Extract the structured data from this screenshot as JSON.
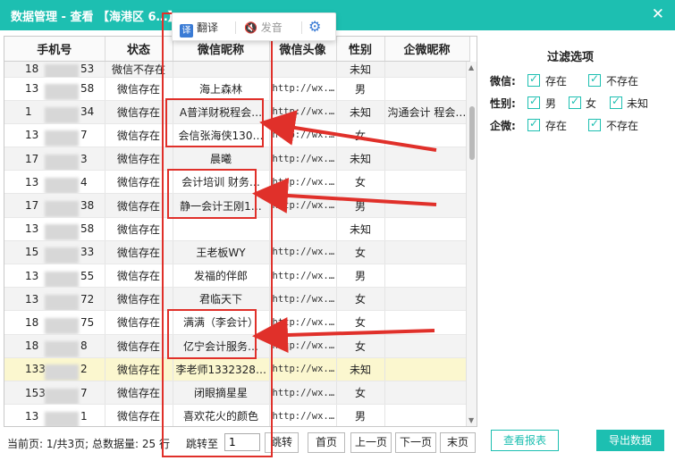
{
  "window": {
    "title": "数据管理 - 查看 【海港区 6…】",
    "close_icon": "close-icon"
  },
  "toolbar": {
    "translate_label": "翻译",
    "translate_icon_text": "译",
    "voice_label": "发音",
    "voice_icon": "speaker-icon",
    "settings_icon": "gear-icon"
  },
  "table": {
    "columns": [
      "手机号",
      "状态",
      "微信昵称",
      "微信头像",
      "性别",
      "企微昵称"
    ],
    "rows": [
      {
        "phone_prefix": "18",
        "phone_suffix": "53",
        "status": "微信不存在",
        "nickname": "",
        "avatar": "",
        "gender": "未知",
        "wecom": ""
      },
      {
        "phone_prefix": "13",
        "phone_suffix": "58",
        "status": "微信存在",
        "nickname": "海上森林",
        "avatar": "http://wx.…",
        "gender": "男",
        "wecom": ""
      },
      {
        "phone_prefix": "1",
        "phone_suffix": "34",
        "status": "微信存在",
        "nickname": "A普洋财税程会…",
        "avatar": "http://wx.…",
        "gender": "未知",
        "wecom": "沟通会计 程会…"
      },
      {
        "phone_prefix": "13",
        "phone_suffix": "7",
        "status": "微信存在",
        "nickname": "会信张海侠130…",
        "avatar": "http://wx.…",
        "gender": "女",
        "wecom": ""
      },
      {
        "phone_prefix": "17",
        "phone_suffix": "3",
        "status": "微信存在",
        "nickname": "晨曦",
        "avatar": "http://wx.…",
        "gender": "未知",
        "wecom": ""
      },
      {
        "phone_prefix": "13",
        "phone_suffix": "4",
        "status": "微信存在",
        "nickname": "会计培训 财务…",
        "avatar": "http://wx.…",
        "gender": "女",
        "wecom": ""
      },
      {
        "phone_prefix": "17",
        "phone_suffix": "38",
        "status": "微信存在",
        "nickname": "静一会计王刚1…",
        "avatar": "http://wx.…",
        "gender": "男",
        "wecom": ""
      },
      {
        "phone_prefix": "13",
        "phone_suffix": "58",
        "status": "微信存在",
        "nickname": "",
        "avatar": "",
        "gender": "未知",
        "wecom": ""
      },
      {
        "phone_prefix": "15",
        "phone_suffix": "33",
        "status": "微信存在",
        "nickname": "王老板WY",
        "avatar": "http://wx.…",
        "gender": "女",
        "wecom": ""
      },
      {
        "phone_prefix": "13",
        "phone_suffix": "55",
        "status": "微信存在",
        "nickname": "发福的伴郎",
        "avatar": "http://wx.…",
        "gender": "男",
        "wecom": ""
      },
      {
        "phone_prefix": "13",
        "phone_suffix": "72",
        "status": "微信存在",
        "nickname": "君临天下",
        "avatar": "http://wx.…",
        "gender": "女",
        "wecom": ""
      },
      {
        "phone_prefix": "18",
        "phone_suffix": "75",
        "status": "微信存在",
        "nickname": "满满（李会计）",
        "avatar": "http://wx.…",
        "gender": "女",
        "wecom": ""
      },
      {
        "phone_prefix": "18",
        "phone_suffix": "8",
        "status": "微信存在",
        "nickname": "亿宁会计服务…",
        "avatar": "http://wx.…",
        "gender": "女",
        "wecom": ""
      },
      {
        "phone_prefix": "133",
        "phone_suffix": "2",
        "status": "微信存在",
        "nickname": "李老师1332328…",
        "avatar": "http://wx.…",
        "gender": "未知",
        "wecom": ""
      },
      {
        "phone_prefix": "153",
        "phone_suffix": "7",
        "status": "微信存在",
        "nickname": "闭眼摘星星",
        "avatar": "http://wx.…",
        "gender": "女",
        "wecom": ""
      },
      {
        "phone_prefix": "13",
        "phone_suffix": "1",
        "status": "微信存在",
        "nickname": "喜欢花火的颜色",
        "avatar": "http://wx.…",
        "gender": "男",
        "wecom": ""
      }
    ]
  },
  "pagination": {
    "info": "当前页: 1/共3页; 总数据量: 25",
    "rows_suffix": "行",
    "jump_label": "跳转至",
    "jump_value": "1",
    "jump_button": "跳转",
    "first": "首页",
    "prev": "上一页",
    "next": "下一页",
    "last": "末页"
  },
  "filters": {
    "title": "过滤选项",
    "wechat": {
      "label": "微信:",
      "options": [
        "存在",
        "不存在"
      ]
    },
    "gender": {
      "label": "性别:",
      "options": [
        "男",
        "女",
        "未知"
      ]
    },
    "wecom": {
      "label": "企微:",
      "options": [
        "存在",
        "不存在"
      ]
    }
  },
  "actions": {
    "report": "查看报表",
    "export": "导出数据"
  },
  "colors": {
    "accent": "#1dbfb1",
    "annotation": "#e0302a",
    "highlight_row": "#fbf7cf"
  }
}
